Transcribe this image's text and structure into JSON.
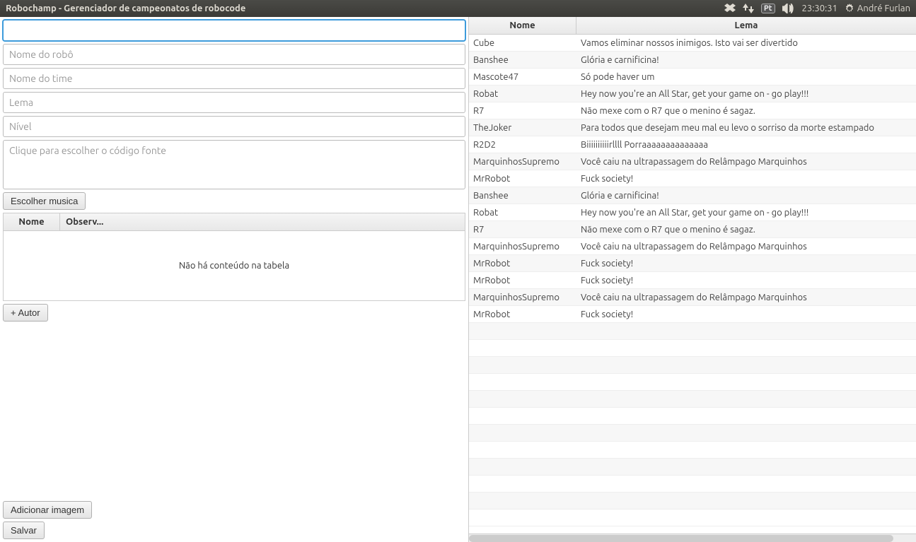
{
  "menubar": {
    "title": "Robochamp - Gerenciador de campeonatos de robocode",
    "lang": "Pt",
    "time": "23:30:31",
    "user": "André Furlan"
  },
  "form": {
    "field0_placeholder": "",
    "robot_name_placeholder": "Nome do robô",
    "team_name_placeholder": "Nome do time",
    "motto_placeholder": "Lema",
    "level_placeholder": "Nível",
    "source_placeholder": "Clique para escolher o código fonte",
    "choose_music": "Escolher musica",
    "add_author": "+ Autor",
    "add_image": "Adicionar imagem",
    "save": "Salvar"
  },
  "mini_table": {
    "col_name": "Nome",
    "col_obs": "Observ...",
    "empty": "Não há conteúdo na tabela"
  },
  "table": {
    "col_name": "Nome",
    "col_motto": "Lema",
    "rows": [
      {
        "name": "Cube",
        "motto": "Vamos eliminar nossos inimigos. Isto vai ser divertido"
      },
      {
        "name": "Banshee",
        "motto": "Glória e carnificina!"
      },
      {
        "name": "Mascote47",
        "motto": "Só pode haver um"
      },
      {
        "name": "Robat",
        "motto": "Hey now you're an All Star, get your game on - go play!!!"
      },
      {
        "name": "R7",
        "motto": "Não mexe com o R7 que o menino é sagaz."
      },
      {
        "name": "TheJoker",
        "motto": "Para todos que desejam meu mal eu levo o sorriso da morte estampado"
      },
      {
        "name": "R2D2",
        "motto": "Biiiiiiiiiirllll Porraaaaaaaaaaaaaa"
      },
      {
        "name": "MarquinhosSupremo",
        "motto": "Você caiu na ultrapassagem do Relâmpago Marquinhos"
      },
      {
        "name": "MrRobot",
        "motto": "Fuck society!"
      },
      {
        "name": "Banshee",
        "motto": "Glória e carnificina!"
      },
      {
        "name": "Robat",
        "motto": "Hey now you're an All Star, get your game on - go play!!!"
      },
      {
        "name": "R7",
        "motto": "Não mexe com o R7 que o menino é sagaz."
      },
      {
        "name": "MarquinhosSupremo",
        "motto": "Você caiu na ultrapassagem do Relâmpago Marquinhos"
      },
      {
        "name": "MrRobot",
        "motto": "Fuck society!"
      },
      {
        "name": "MrRobot",
        "motto": "Fuck society!"
      },
      {
        "name": "MarquinhosSupremo",
        "motto": "Você caiu na ultrapassagem do Relâmpago Marquinhos"
      },
      {
        "name": "MrRobot",
        "motto": "Fuck society!"
      }
    ],
    "empty_rows": 12
  }
}
